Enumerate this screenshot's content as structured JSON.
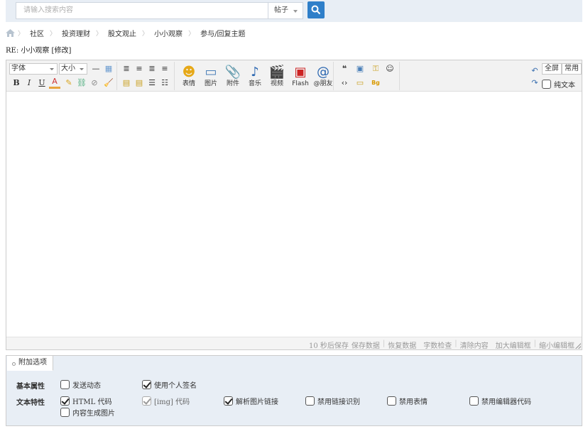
{
  "search": {
    "placeholder": "请输入搜索内容",
    "type_value": "帖子"
  },
  "breadcrumb": [
    "社区",
    "投资理财",
    "股文观止",
    "小小观察",
    "参与/回复主题"
  ],
  "subject": "RE: 小小观察 [修改]",
  "toolbar": {
    "font_label": "字体",
    "size_label": "大小",
    "media_buttons": [
      "表情",
      "图片",
      "附件",
      "音乐",
      "视频",
      "Flash",
      "@朋友"
    ],
    "fullscreen_label": "全屏",
    "common_label": "常用",
    "plaintext_label": "纯文本"
  },
  "status": {
    "items": [
      "10 秒后保存",
      "保存数据",
      "恢复数据",
      "字数检查",
      "清除内容",
      "加大编辑框",
      "缩小编辑框"
    ]
  },
  "options": {
    "tab_label": "附加选项",
    "basic_label": "基本属性",
    "text_label": "文本特性",
    "basic": [
      {
        "label": "发送动态",
        "checked": false
      },
      {
        "label": "使用个人签名",
        "checked": true
      }
    ],
    "text": [
      {
        "label": "HTML 代码",
        "checked": true,
        "disabled": false
      },
      {
        "label": "[img] 代码",
        "checked": true,
        "disabled": true
      },
      {
        "label": "解析图片链接",
        "checked": true,
        "disabled": false
      },
      {
        "label": "禁用链接识别",
        "checked": false,
        "disabled": false
      },
      {
        "label": "禁用表情",
        "checked": false,
        "disabled": false
      },
      {
        "label": "禁用编辑器代码",
        "checked": false,
        "disabled": false
      },
      {
        "label": "内容生成图片",
        "checked": false,
        "disabled": false
      }
    ]
  }
}
